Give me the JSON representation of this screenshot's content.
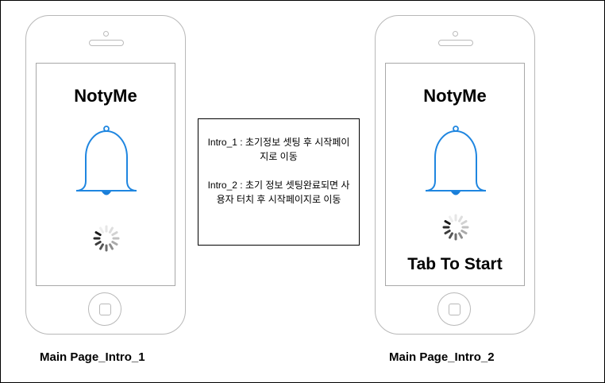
{
  "screens": [
    {
      "app_title": "NotyMe",
      "bell_icon": "bell-icon",
      "spinner_icon": "loading-spinner-icon",
      "caption": "Main Page_Intro_1"
    },
    {
      "app_title": "NotyMe",
      "bell_icon": "bell-icon",
      "spinner_icon": "loading-spinner-icon",
      "start_label": "Tab To Start",
      "caption": "Main Page_Intro_2"
    }
  ],
  "notes": {
    "intro1": "Intro_1 : 초기정보 셋팅 후 시작페이지로 이동",
    "intro2": "Intro_2 : 초기 정보 셋팅완료되면 사용자 터치 후 시작페이지로 이동"
  },
  "colors": {
    "bell_stroke": "#1f86e0",
    "bell_clapper": "#1a7ed8",
    "phone_outline": "#b8b8b8"
  }
}
